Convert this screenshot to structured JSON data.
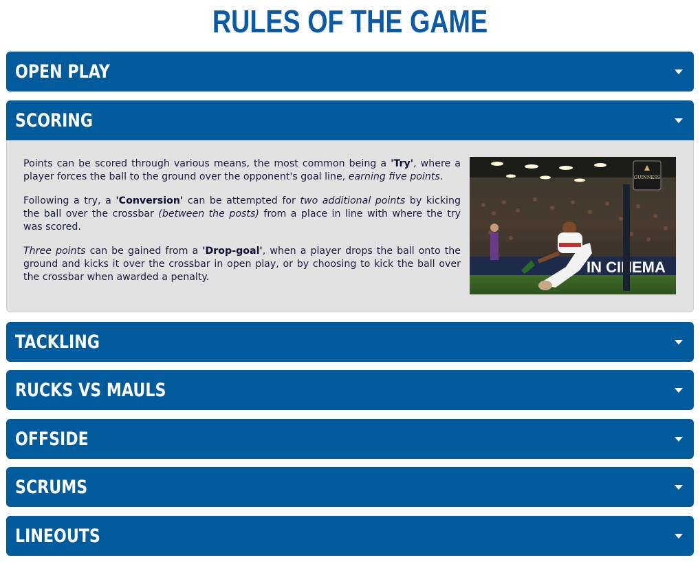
{
  "page": {
    "title": "RULES OF THE GAME"
  },
  "accordion": [
    {
      "label": "OPEN PLAY"
    },
    {
      "label": "SCORING"
    },
    {
      "label": "TACKLING"
    },
    {
      "label": "RUCKS VS MAULS"
    },
    {
      "label": "OFFSIDE"
    },
    {
      "label": "SCRUMS"
    },
    {
      "label": "LINEOUTS"
    }
  ],
  "scoring": {
    "p1": {
      "t1": "Points can be scored through various means, the most common being a ",
      "b1": "'Try'",
      "t2": ", where a player forces the ball to the ground over the opponent's goal line, ",
      "i1": "earning five points",
      "t3": "."
    },
    "p2": {
      "t1": "Following a try, a ",
      "b1": "'Conversion'",
      "t2": " can be attempted for ",
      "i1": "two additional points",
      "t3": " by kicking the ball over the crossbar ",
      "i2": "(between the posts)",
      "t4": " from a place in line with where the try was scored."
    },
    "p3": {
      "i1": "Three points",
      "t1": " can be gained from a ",
      "b1": "'Drop-goal'",
      "t2": ", when a player drops the ball onto the ground and kicks it over the crossbar in open play, or by choosing to kick the ball over the crossbar when awarded a penalty."
    },
    "image": {
      "flag_brand": "GUINNESS",
      "board_text": "IN CINEMA"
    }
  },
  "colors": {
    "header_bg": "#005a9c",
    "title": "#0b5aa5",
    "panel_bg": "#e2e2e2"
  }
}
